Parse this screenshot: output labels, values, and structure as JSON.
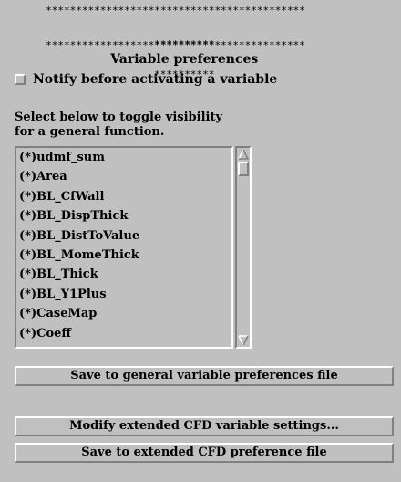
{
  "header": {
    "stars_top": "*******************************************",
    "title_prefix": "**********",
    "title": "Variable preferences",
    "title_suffix": "**********",
    "stars_bottom": "*******************************************"
  },
  "notify": {
    "label": "Notify before activating a variable",
    "checked": false
  },
  "instructions": {
    "line1": "Select below to toggle visibility",
    "line2": "for a general function."
  },
  "function_list": {
    "items": [
      "(*)udmf_sum",
      "(*)Area",
      "(*)BL_CfWall",
      "(*)BL_DispThick",
      "(*)BL_DistToValue",
      "(*)BL_MomeThick",
      "(*)BL_Thick",
      "(*)BL_Y1Plus",
      "(*)CaseMap",
      "(*)Coeff"
    ]
  },
  "buttons": {
    "save_general": "Save to general variable preferences file",
    "modify_extended": "Modify extended CFD variable settings...",
    "save_extended": "Save to extended CFD preference file"
  },
  "colors": {
    "background": "#c0c0c0",
    "highlight": "#ffffff",
    "shadow": "#808080",
    "text": "#000000"
  }
}
